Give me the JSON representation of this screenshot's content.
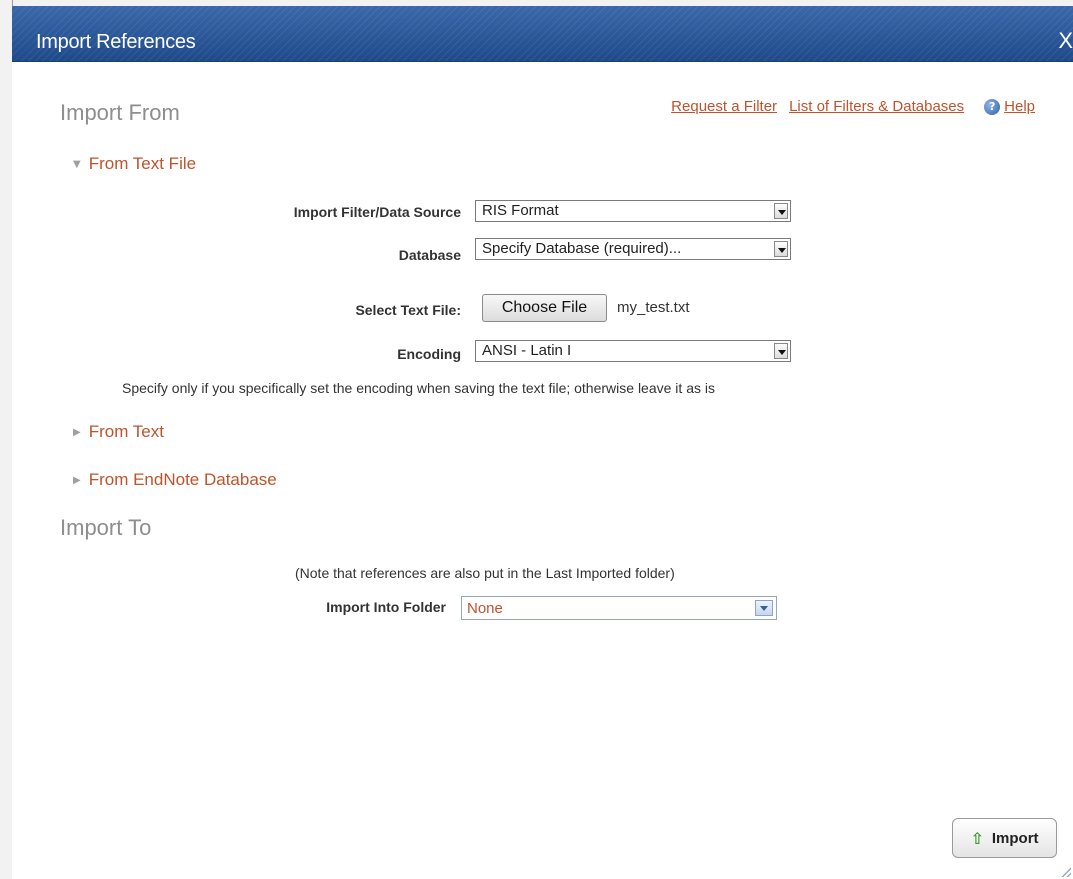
{
  "dialog": {
    "title": "Import References",
    "close_label": "X"
  },
  "import_from": {
    "heading": "Import From",
    "links": {
      "request_filter": "Request a Filter",
      "list_filters": "List of Filters & Databases",
      "help": "Help"
    },
    "from_text_file": {
      "label": "From Text File",
      "expanded": true,
      "filter_label": "Import Filter/Data Source",
      "filter_value": "RIS Format",
      "database_label": "Database",
      "database_value": "Specify Database (required)...",
      "file_label": "Select Text File:",
      "choose_file_label": "Choose File",
      "file_name": "my_test.txt",
      "encoding_label": "Encoding",
      "encoding_value": "ANSI - Latin I",
      "encoding_hint": "Specify only if you specifically set the encoding when saving the text file; otherwise leave it as is"
    },
    "from_text": {
      "label": "From Text",
      "expanded": false
    },
    "from_endnote": {
      "label": "From EndNote Database",
      "expanded": false
    }
  },
  "import_to": {
    "heading": "Import To",
    "note": "(Note that references are also put in the Last Imported folder)",
    "folder_label": "Import Into Folder",
    "folder_value": "None"
  },
  "actions": {
    "import_label": "Import"
  },
  "icons": {
    "help": "help-icon",
    "import": "up-arrow-icon",
    "expanded": "triangle-down-icon",
    "collapsed": "triangle-right-icon"
  },
  "colors": {
    "titlebar": "#2a5696",
    "link": "#c0532b",
    "section_heading": "#8e8e8e"
  }
}
